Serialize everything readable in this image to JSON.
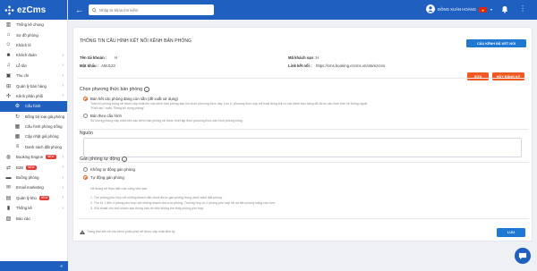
{
  "brand": {
    "name": "ezCms",
    "color": "#1f5fbf"
  },
  "sidebar": {
    "items": [
      {
        "label": "Thống kê chung",
        "icon": "chart-icon",
        "chevron": false
      },
      {
        "label": "Sơ đồ phòng",
        "icon": "home-icon",
        "chevron": false
      },
      {
        "label": "Khách lẻ",
        "icon": "user-icon",
        "chevron": false
      },
      {
        "label": "Khách đoàn",
        "icon": "users-icon",
        "chevron": true
      },
      {
        "label": "Lễ tân",
        "icon": "bell-icon",
        "chevron": true
      },
      {
        "label": "Thu chi",
        "icon": "wallet-icon",
        "chevron": true
      },
      {
        "label": "Quản lý bán hàng",
        "icon": "cart-icon",
        "chevron": true
      },
      {
        "label": "Kênh phân phối",
        "icon": "network-icon",
        "chevron": true
      },
      {
        "label": "Cấu hình",
        "icon": "settings-icon",
        "sub": true,
        "active": true
      },
      {
        "label": "Đồng bộ loại giá phòng",
        "icon": "sync-icon",
        "sub": true
      },
      {
        "label": "Cấu hình phòng trống",
        "icon": "grid-icon",
        "sub": true
      },
      {
        "label": "Cập nhật giá phòng",
        "icon": "grid-icon",
        "sub": true
      },
      {
        "label": "Danh sách đặt phòng",
        "icon": "list-icon",
        "sub": true
      },
      {
        "label": "Booking Engine",
        "icon": "globe-icon",
        "chevron": true,
        "badge": "NEW"
      },
      {
        "label": "B2B",
        "icon": "b2b-icon",
        "chevron": true,
        "badge": "NEW"
      },
      {
        "label": "Buồng phòng",
        "icon": "bed-icon",
        "chevron": true
      },
      {
        "label": "Email marketing",
        "icon": "mail-icon",
        "chevron": true
      },
      {
        "label": "Quản lý kho",
        "icon": "box-icon",
        "chevron": true,
        "badge": "NEW"
      },
      {
        "label": "Thống kê",
        "icon": "stats-icon",
        "chevron": true
      },
      {
        "label": "Báo cáo",
        "icon": "report-icon",
        "chevron": false
      }
    ],
    "footer": "«"
  },
  "topbar": {
    "search_placeholder": "Nhập từ khóa tìm kiếm",
    "user_name": "ĐỒNG XUÂN HOÀNG"
  },
  "page": {
    "title": "THÔNG TIN CẤU HÌNH KẾT NỐI KÊNH BÁN PHÒNG",
    "config_button": "CẤU KÊNH ĐÃ KẾT NỐI",
    "fields": {
      "hotel_name_label": "Tên tài khoản :",
      "hotel_name_value": "H",
      "password_label": "Mật khẩu :",
      "password_value": "AMJ123",
      "customer_code_label": "Mã khách sạn :",
      "customer_code_value": "H",
      "link_label": "Link kết nối :",
      "link_value": "https://cms.booking.ezcms.vn/ota/ezcms"
    },
    "edit_button": "SỬA",
    "cancel_button": "HỦY ĐĂNG KÝ",
    "sell_method": {
      "title": "Chọn phương thức bán phòng",
      "options": [
        {
          "label": "Bán hết các phòng đang còn sẵn (đề xuất sử dụng)",
          "desc1": "Toàn bộ phòng trống sẽ được cập nhật lên các kênh bán phòng sau khi chọn phương thức này. Lưu ý, phương thức này chỉ hoạt động khi có các kênh bán hàng đã được cấu hình trên hệ thống ngoài.",
          "desc2": "\"Khởi tạo\" hoặc \"Đang sử dụng phòng\"",
          "checked": true
        },
        {
          "label": "Bán theo cấu hình",
          "desc1": "Số lượng phòng cập nhật trên các kênh bán phòng sẽ được thiết lập theo phương thức cấu hình phòng trống.",
          "desc2": "",
          "checked": false
        }
      ]
    },
    "note_label": "Nguồn",
    "auto_assign": {
      "title": "Gán phòng tự động",
      "options": [
        {
          "label": "Không tự động gán phòng",
          "checked": false
        },
        {
          "label": "Tự động gán phòng",
          "checked": true
        }
      ],
      "intro": "Hệ thống sẽ thực hiện các công việc sau:",
      "steps": [
        "1. Tìm phòng phù hợp với những khách vẫn chưa được gán phòng trong danh sách đặt phòng.",
        "2. Tìm từ 1 đến 4 phòng phù hợp với những khách chưa có phòng. Trường hợp có 2 phòng phù hợp sẽ ưu tiên phòng hạng cao hơn.",
        "3. Gửi email cho chủ khách sạn thông báo về việc không tìm thấy phòng phù hợp."
      ]
    },
    "footer_note": "Trạng thái kết nối các kênh phân phối sẽ được cập nhật định kỳ",
    "save_button": "LƯU"
  }
}
